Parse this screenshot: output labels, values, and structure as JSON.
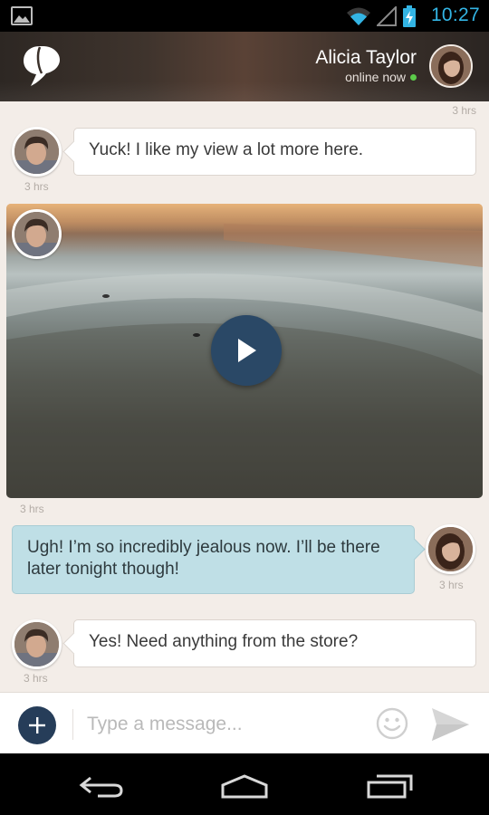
{
  "status_bar": {
    "time": "10:27",
    "icons": [
      "gallery-icon",
      "wifi-icon",
      "signal-icon",
      "battery-charging-icon"
    ],
    "accent_color": "#33b5e5"
  },
  "header": {
    "contact_name": "Alicia Taylor",
    "contact_status": "online now",
    "online_color": "#5ccb4a"
  },
  "messages": [
    {
      "sender": "other",
      "type": "text",
      "text": "",
      "time": "3 hrs",
      "time_align": "right"
    },
    {
      "sender": "other",
      "type": "text",
      "text": "Yuck! I like my view a lot more here.",
      "time": "3 hrs"
    },
    {
      "sender": "other",
      "type": "video",
      "time": "3 hrs"
    },
    {
      "sender": "me",
      "type": "text",
      "text": "Ugh! I’m so incredibly jealous now. I’ll be there later tonight though!",
      "time": "3 hrs"
    },
    {
      "sender": "other",
      "type": "text",
      "text": "Yes! Need anything from the store?",
      "time": "3 hrs"
    }
  ],
  "composer": {
    "placeholder": "Type a message...",
    "value": ""
  },
  "colors": {
    "chat_background": "#f3ede8",
    "outgoing_bubble": "#bfdfe6",
    "incoming_bubble": "#ffffff",
    "add_button": "#263d59",
    "play_button": "#2a4866"
  }
}
